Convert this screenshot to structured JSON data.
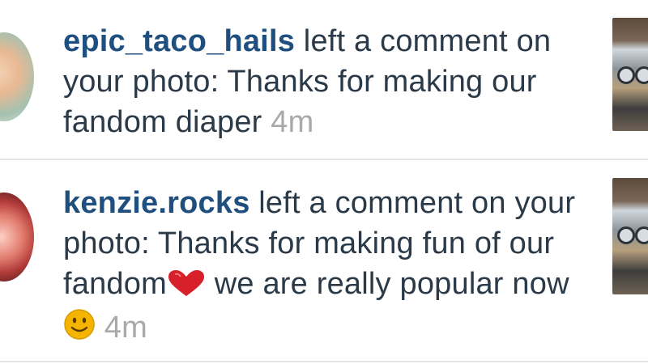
{
  "notifications": [
    {
      "username": "epic_taco_hails",
      "action": " left a comment on your photo: Thanks for making our fandom diaper ",
      "time": "4m"
    },
    {
      "username": "kenzie.rocks",
      "action_part1": " left a comment on your photo: Thanks for making fun of our fandom",
      "action_part2": " we are really popular now",
      "time": "4m"
    }
  ],
  "icons": {
    "heart": "heart-icon",
    "smiley": "smiley-icon"
  },
  "colors": {
    "username": "#1f4f7f",
    "text": "#2b3a48",
    "timestamp": "#a9a9a9",
    "divider": "#e6e6e6",
    "heart": "#d8202a",
    "smiley": "#f4b400"
  }
}
